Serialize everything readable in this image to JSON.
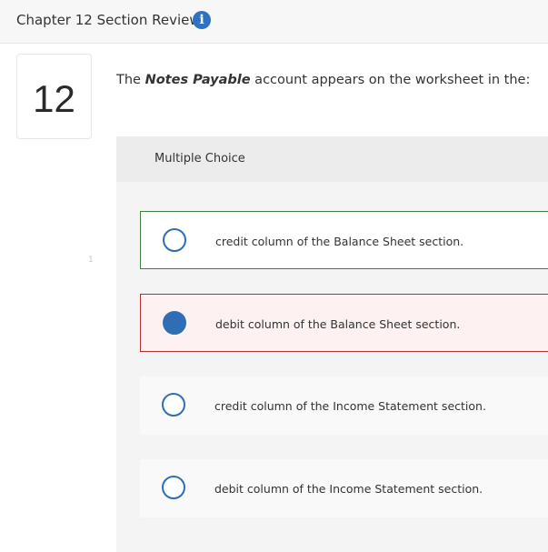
{
  "header": {
    "title": "Chapter 12 Section Review",
    "info_icon_glyph": "i"
  },
  "question": {
    "number": "12",
    "prefix": "The ",
    "emphasis": "Notes Payable",
    "suffix": " account appears on the worksheet in the:"
  },
  "stray_mark": "1",
  "choices": {
    "title": "Multiple Choice",
    "options": [
      {
        "label": "credit column of the Balance Sheet section.",
        "selected": false,
        "state": "correct"
      },
      {
        "label": "debit column of the Balance Sheet section.",
        "selected": true,
        "state": "incorrect"
      },
      {
        "label": "credit column of the Income Statement section.",
        "selected": false,
        "state": "plain"
      },
      {
        "label": "debit column of the Income Statement section.",
        "selected": false,
        "state": "plain"
      }
    ]
  },
  "colors": {
    "accent_blue": "#2f72c4",
    "correct_border": "#3f7f3f",
    "incorrect_border": "#b72c2c",
    "incorrect_bg": "#fdf1f1"
  },
  "icons": {
    "info": "info-icon",
    "radio": "radio-icon"
  }
}
